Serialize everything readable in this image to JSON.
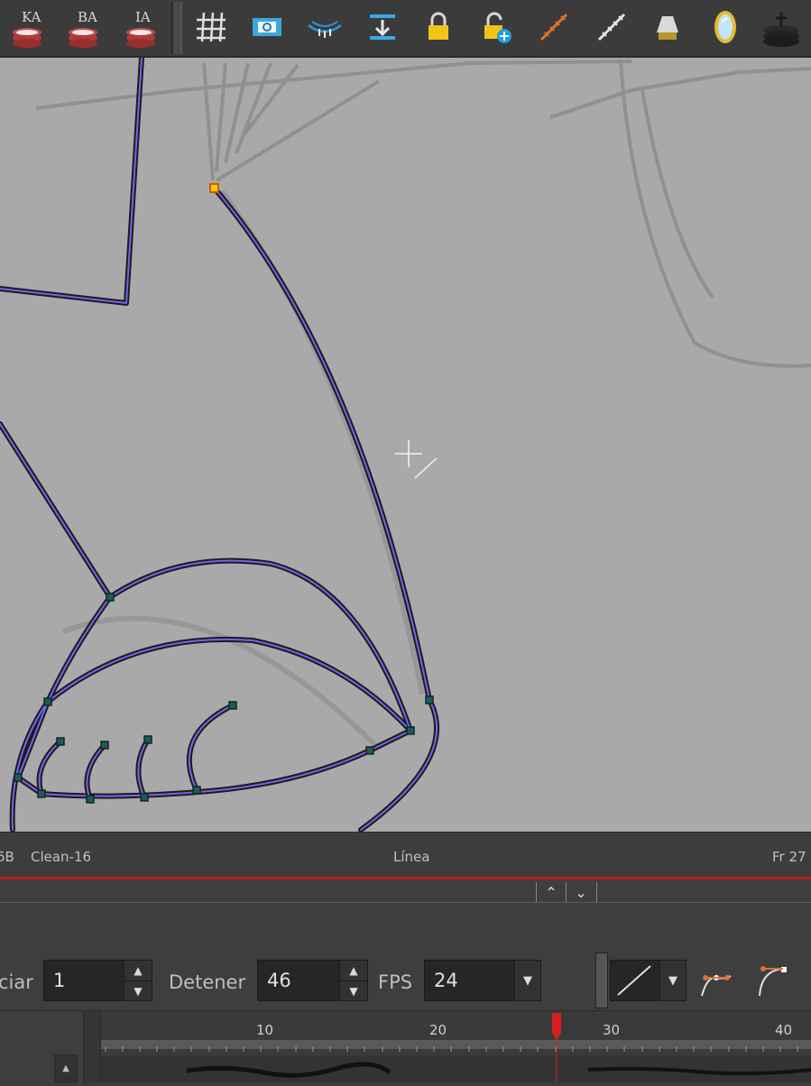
{
  "toolbar": {
    "buttons": [
      {
        "name": "ka-layer-button",
        "label": "KA",
        "icon": "onion-skin-stack-icon"
      },
      {
        "name": "ba-layer-button",
        "label": "BA",
        "icon": "onion-skin-stack-icon"
      },
      {
        "name": "ia-layer-button",
        "label": "IA",
        "icon": "onion-skin-stack-icon"
      },
      {
        "name": "grid-button",
        "icon": "grid-icon"
      },
      {
        "name": "camera-mask-button",
        "icon": "camera-mask-icon"
      },
      {
        "name": "light-table-button",
        "icon": "light-table-icon"
      },
      {
        "name": "flatten-button",
        "icon": "flatten-icon"
      },
      {
        "name": "lock-button",
        "icon": "lock-icon"
      },
      {
        "name": "unlock-all-button",
        "icon": "unlock-add-icon"
      },
      {
        "name": "ruler-button",
        "icon": "ruler-orange-icon"
      },
      {
        "name": "ruler-2-button",
        "icon": "ruler-white-icon"
      },
      {
        "name": "lamp-button",
        "icon": "lamp-icon"
      },
      {
        "name": "mirror-button",
        "icon": "mirror-icon"
      },
      {
        "name": "stack-button",
        "icon": "stack-icon"
      }
    ]
  },
  "status": {
    "left_fragment": "6B",
    "drawing_name": "Clean-16",
    "tool": "Línea",
    "frame": "Fr 27"
  },
  "playback": {
    "start_label": "ciar",
    "start_value": "1",
    "stop_label": "Detener",
    "stop_value": "46",
    "fps_label": "FPS",
    "fps_value": "24"
  },
  "timeline": {
    "frame_labels": [
      "10",
      "20",
      "30",
      "40"
    ],
    "current_frame": 27
  },
  "colors": {
    "accent_red": "#d42020",
    "stroke_blue": "#4a6cff",
    "canvas_bg": "#a9a9a9"
  }
}
